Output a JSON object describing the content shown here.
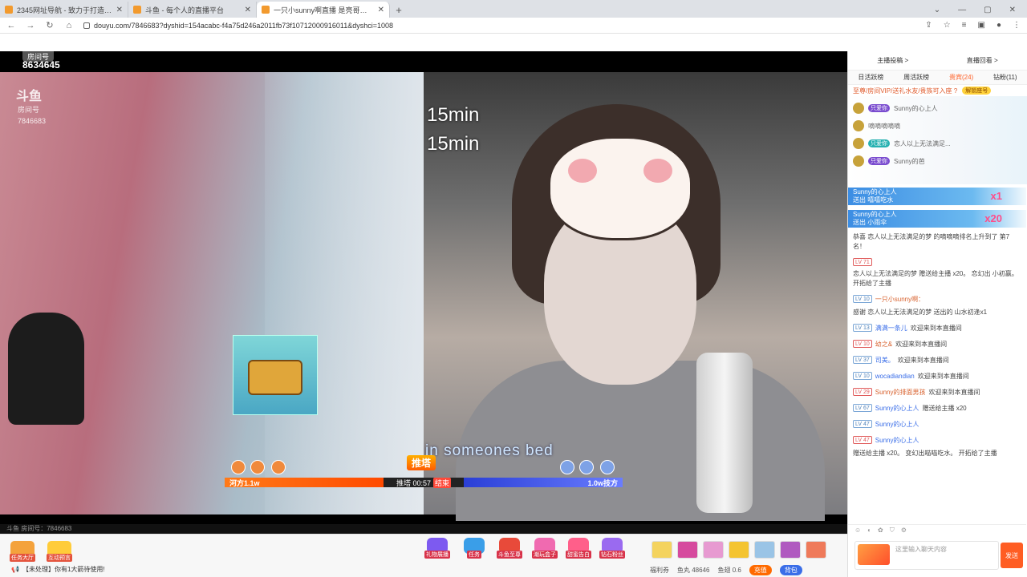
{
  "browser": {
    "tabs": [
      {
        "title": "2345网址导航 - 致力于打造百年品牌",
        "active": false
      },
      {
        "title": "斗鱼 - 每个人的直播平台",
        "active": false
      },
      {
        "title": "一只小sunny啊直播 是亮哥的直播间",
        "active": true
      }
    ],
    "new_tab": "+",
    "url": "douyu.com/7846683?dyshid=154acabc-f4a75d246a2011fb73f10712000916011&dyshci=1008",
    "controls": {
      "minimize": "⌄",
      "restore": "—",
      "maximize": "▢",
      "close": "✕"
    }
  },
  "video": {
    "room_label": "房间号",
    "room_number": "8634645",
    "logo": "斗鱼",
    "logo_sub": "房间号",
    "logo_room": "7846683",
    "timer_1": "15min",
    "timer_2": "15min",
    "lyric": "in someones bed",
    "pk": {
      "tag": "推塔",
      "left_score": "河方1.1w",
      "center": "推塔 00:57",
      "end_label": "结束",
      "right_score": "1.0w技方",
      "left_progress": 0.4
    },
    "footer_room": "斗鱼 房间号：7846683"
  },
  "bottom": {
    "left_btns": [
      {
        "label": "任务大厅",
        "color": "#f4a23c"
      },
      {
        "label": "互动预言",
        "color": "#ffcc3a"
      }
    ],
    "features": [
      {
        "label": "礼物展播",
        "color": "#7d5af0"
      },
      {
        "label": "任务",
        "color": "#3a9ee8"
      },
      {
        "label": "斗鱼至尊",
        "color": "#e84a3a"
      },
      {
        "label": "潮玩盒子",
        "color": "#f06ab0"
      },
      {
        "label": "甜蜜告白",
        "color": "#ff5f8a"
      },
      {
        "label": "钻石粉丝",
        "color": "#9a6af0"
      }
    ],
    "notice": "【未处理】你有1大箭待使用!",
    "stats": {
      "fish_balls": "鱼丸 48646",
      "fish_wings": "鱼翅 0.6",
      "charge": "充值",
      "fans": "背包",
      "welfare": "福利券"
    }
  },
  "panel": {
    "top_tabs": [
      "主播投稿 >",
      "直播回看 >"
    ],
    "tabs": [
      "日活跃榜",
      "周活跃榜",
      "贵宾(24)",
      "钻粉(11)"
    ],
    "vip_text": "至尊/房间VIP/送礼水友/贵族可入座 ?",
    "vip_btn": "解锁座号",
    "fans": [
      {
        "chip": "只爱你",
        "name": "Sunny的心上人",
        "chip_color": "violet"
      },
      {
        "chip": "",
        "name": "嘀嘀嘀嘀嘀",
        "chip_color": "violet"
      },
      {
        "chip": "只爱你",
        "name": "恋人以上无法满足...",
        "chip_color": "teal"
      },
      {
        "chip": "只爱你",
        "name": "Sunny的芭",
        "chip_color": "violet"
      }
    ],
    "gift_banners": [
      {
        "user": "Sunny的心上人",
        "action": "送出  嘻嘻吃水",
        "count": "x1"
      },
      {
        "user": "Sunny的心上人",
        "action": "送出  小雨伞",
        "count": "x20"
      }
    ],
    "messages": [
      {
        "lv": "",
        "nick": "",
        "text": "恭喜 恋人以上无法满足的梦 的嘀嘀嘀排名上升到了 第7名！",
        "blue": false
      },
      {
        "lv": "LV 71",
        "nick": "",
        "text": "恋人以上无法满足的梦 赠送给主播 x20。 恋幻出 小初赢。 开拓给了主播",
        "blue": false
      },
      {
        "lv": "LV 10",
        "nick": "一只小sunny啊：",
        "text": "感谢 恋人以上无法满足的梦 送出的 山水初逢x1",
        "blue": false
      },
      {
        "lv": "LV 13",
        "nick": "满满一条儿",
        "text": "欢迎来到本直播间",
        "blue": true
      },
      {
        "lv": "LV 10",
        "nick": "幼之&",
        "text": "欢迎来到本直播间",
        "blue": false
      },
      {
        "lv": "LV 37",
        "nick": "司美。",
        "text": "欢迎来到本直播间",
        "blue": true
      },
      {
        "lv": "LV 10",
        "nick": "wocadiandian",
        "text": "欢迎来到本直播间",
        "blue": true
      },
      {
        "lv": "LV 29",
        "nick": "Sunny的排面男孩",
        "text": "欢迎来到本直播间",
        "blue": false
      },
      {
        "lv": "LV 67",
        "nick": "Sunny的心上人",
        "text": "赠送给主播 x20",
        "blue": true
      },
      {
        "lv": "LV 47",
        "nick": "Sunny的心上人",
        "text": "",
        "blue": true
      },
      {
        "lv": "LV 47",
        "nick": "Sunny的心上人",
        "text": "赠送给主播 x20。 变幻出喵喵吃水。 开拓给了主播",
        "blue": true
      }
    ],
    "input_placeholder": "这里输入聊天内容",
    "send": "发送"
  },
  "colors": {
    "accent": "#ff5d23",
    "pk_left": "#ff4a00",
    "pk_right": "#3a4fe0"
  }
}
